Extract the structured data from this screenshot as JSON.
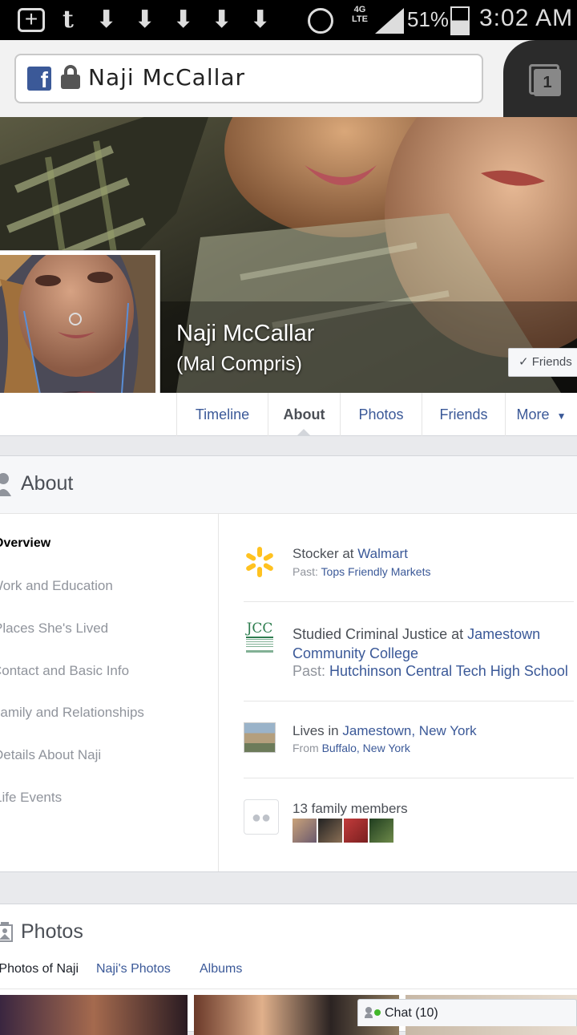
{
  "status_bar": {
    "battery": "51%",
    "time": "3:02 AM",
    "network": "4G LTE"
  },
  "browser": {
    "url_title": "Naji McCallar",
    "tab_count": "1"
  },
  "profile": {
    "name": "Naji McCallar",
    "alt_name": "(Mal Compris)",
    "friends_button": "Friends"
  },
  "tabs": [
    {
      "label": "Timeline"
    },
    {
      "label": "About"
    },
    {
      "label": "Photos"
    },
    {
      "label": "Friends"
    },
    {
      "label": "More"
    }
  ],
  "about": {
    "heading": "About",
    "nav": [
      "Overview",
      "Work and Education",
      "Places She's Lived",
      "Contact and Basic Info",
      "Family and Relationships",
      "Details About Naji",
      "Life Events"
    ],
    "work": {
      "prefix": "Stocker at ",
      "employer": "Walmart",
      "past_label": "Past: ",
      "past": "Tops Friendly Markets"
    },
    "education": {
      "prefix": "Studied Criminal Justice at ",
      "school": "Jamestown Community College",
      "past_label": "Past: ",
      "past": "Hutchinson Central Tech High School",
      "logo_text": "JCC"
    },
    "lives": {
      "prefix": "Lives in ",
      "city": "Jamestown, New York",
      "from_label": "From ",
      "from": "Buffalo, New York"
    },
    "family": {
      "text": "13 family members"
    }
  },
  "photos": {
    "heading": "Photos",
    "tabs": [
      "Photos of Naji",
      "Naji's Photos",
      "Albums"
    ]
  },
  "chat": {
    "label": "Chat (10)"
  },
  "colors": {
    "facebook_blue": "#3b5998",
    "link": "#3b5998",
    "walmart_yellow": "#ffc220",
    "jcc_green": "#2e7d4f"
  }
}
